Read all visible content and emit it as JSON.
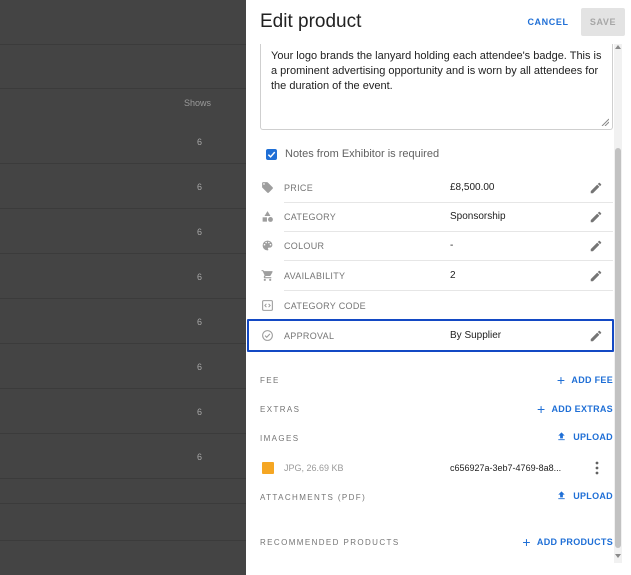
{
  "backdrop": {
    "column_header": "Shows",
    "rows": [
      "6",
      "6",
      "6",
      "6",
      "6",
      "6",
      "6",
      "6"
    ]
  },
  "panel": {
    "title": "Edit product",
    "cancel_label": "CANCEL",
    "save_label": "SAVE"
  },
  "description": {
    "text": "Your logo brands the lanyard holding each attendee's badge. This is a prominent advertising opportunity and is worn by all attendees for the duration of the event."
  },
  "notes_checkbox": {
    "label": "Notes from Exhibitor is required",
    "checked": true
  },
  "properties": [
    {
      "label": "PRICE",
      "value": "£8,500.00",
      "icon": "tag-icon",
      "editable": true
    },
    {
      "label": "CATEGORY",
      "value": "Sponsorship",
      "icon": "category-icon",
      "editable": true
    },
    {
      "label": "COLOUR",
      "value": "-",
      "icon": "palette-icon",
      "editable": true
    },
    {
      "label": "AVAILABILITY",
      "value": "2",
      "icon": "cart-icon",
      "editable": true
    },
    {
      "label": "CATEGORY CODE",
      "value": "",
      "icon": "code-icon",
      "editable": false
    },
    {
      "label": "APPROVAL",
      "value": "By Supplier",
      "icon": "check-circle-icon",
      "editable": true
    }
  ],
  "sections": {
    "fee": {
      "label": "FEE",
      "action": "ADD FEE"
    },
    "extras": {
      "label": "EXTRAS",
      "action": "ADD EXTRAS"
    },
    "images": {
      "label": "IMAGES",
      "action": "UPLOAD"
    },
    "attachments": {
      "label": "ATTACHMENTS (PDF)",
      "action": "UPLOAD"
    },
    "recommended": {
      "label": "RECOMMENDED PRODUCTS",
      "action": "ADD PRODUCTS"
    }
  },
  "image_file": {
    "meta": "JPG, 26.69 KB",
    "name": "c656927a-3eb7-4769-8a8..."
  },
  "colors": {
    "accent": "#1f6fd6",
    "highlight": "#1349c4",
    "image_thumb": "#f5a623"
  }
}
